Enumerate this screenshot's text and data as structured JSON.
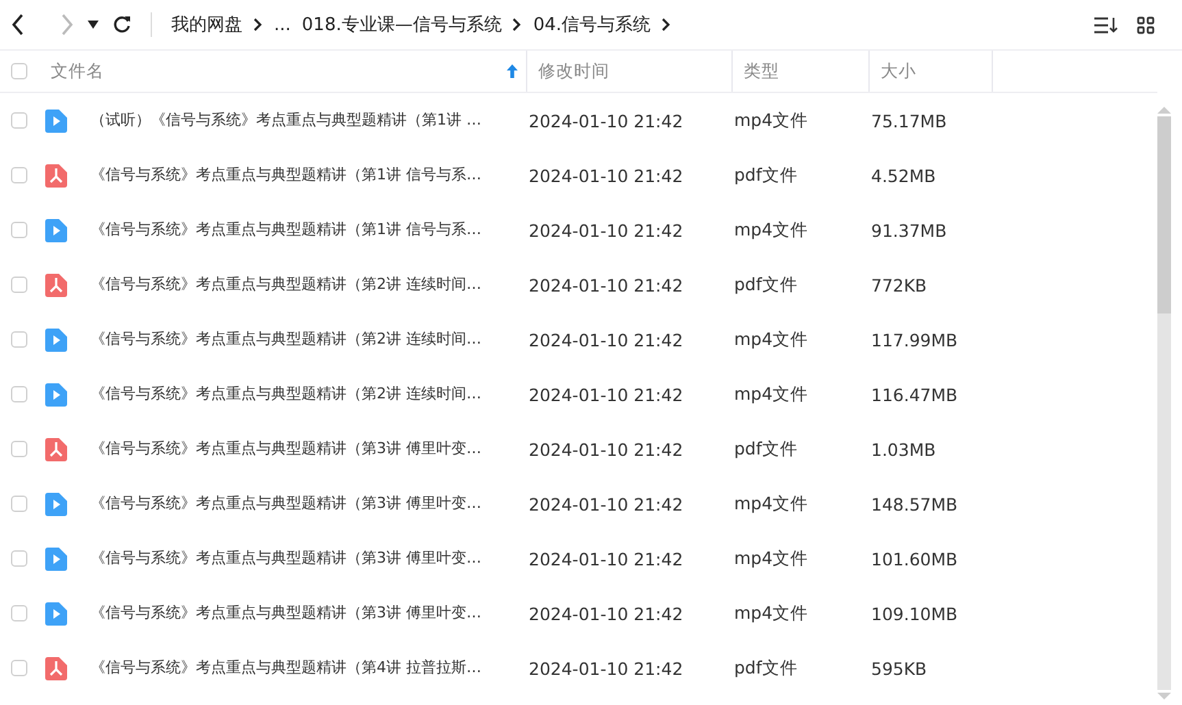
{
  "toolbar": {
    "breadcrumb": [
      {
        "label": "我的网盘"
      },
      {
        "label": "..."
      },
      {
        "label": "018.专业课—信号与系统"
      },
      {
        "label": "04.信号与系统"
      }
    ]
  },
  "table": {
    "select_all": {
      "checked": false
    },
    "columns": [
      {
        "label": "文件名",
        "sorted": true
      },
      {
        "label": "修改时间",
        "sorted": false
      },
      {
        "label": "类型",
        "sorted": false
      },
      {
        "label": "大小",
        "sorted": false
      }
    ],
    "rows": [
      {
        "kind": "video",
        "checked": false,
        "name": "（试听）《信号与系统》考点重点与典型题精讲（第1讲  …",
        "modified": "2024-01-10 21:42",
        "type": "mp4文件",
        "size": "75.17MB"
      },
      {
        "kind": "pdf",
        "checked": false,
        "name": "《信号与系统》考点重点与典型题精讲（第1讲  信号与系…",
        "modified": "2024-01-10 21:42",
        "type": "pdf文件",
        "size": "4.52MB"
      },
      {
        "kind": "video",
        "checked": false,
        "name": "《信号与系统》考点重点与典型题精讲（第1讲  信号与系…",
        "modified": "2024-01-10 21:42",
        "type": "mp4文件",
        "size": "91.37MB"
      },
      {
        "kind": "pdf",
        "checked": false,
        "name": "《信号与系统》考点重点与典型题精讲（第2讲  连续时间…",
        "modified": "2024-01-10 21:42",
        "type": "pdf文件",
        "size": "772KB"
      },
      {
        "kind": "video",
        "checked": false,
        "name": "《信号与系统》考点重点与典型题精讲（第2讲  连续时间…",
        "modified": "2024-01-10 21:42",
        "type": "mp4文件",
        "size": "117.99MB"
      },
      {
        "kind": "video",
        "checked": false,
        "name": "《信号与系统》考点重点与典型题精讲（第2讲  连续时间…",
        "modified": "2024-01-10 21:42",
        "type": "mp4文件",
        "size": "116.47MB"
      },
      {
        "kind": "pdf",
        "checked": false,
        "name": "《信号与系统》考点重点与典型题精讲（第3讲  傅里叶变…",
        "modified": "2024-01-10 21:42",
        "type": "pdf文件",
        "size": "1.03MB"
      },
      {
        "kind": "video",
        "checked": false,
        "name": "《信号与系统》考点重点与典型题精讲（第3讲  傅里叶变…",
        "modified": "2024-01-10 21:42",
        "type": "mp4文件",
        "size": "148.57MB"
      },
      {
        "kind": "video",
        "checked": false,
        "name": "《信号与系统》考点重点与典型题精讲（第3讲  傅里叶变…",
        "modified": "2024-01-10 21:42",
        "type": "mp4文件",
        "size": "101.60MB"
      },
      {
        "kind": "video",
        "checked": false,
        "name": "《信号与系统》考点重点与典型题精讲（第3讲  傅里叶变…",
        "modified": "2024-01-10 21:42",
        "type": "mp4文件",
        "size": "109.10MB"
      },
      {
        "kind": "pdf",
        "checked": false,
        "name": "《信号与系统》考点重点与典型题精讲（第4讲  拉普拉斯…",
        "modified": "2024-01-10 21:42",
        "type": "pdf文件",
        "size": "595KB"
      }
    ]
  }
}
